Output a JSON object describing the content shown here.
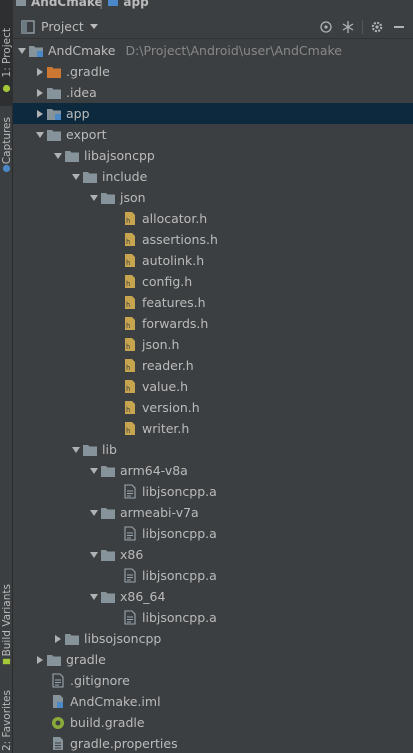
{
  "breadcrumb": {
    "project": "AndCmake",
    "module": "app"
  },
  "left_strip": {
    "tabs": [
      {
        "label": "1: Project"
      },
      {
        "label": "Captures"
      },
      {
        "label": "Build Variants"
      },
      {
        "label": "2: Favorites"
      }
    ]
  },
  "panel": {
    "view_label": "Project"
  },
  "tree": {
    "root": {
      "label": "AndCmake",
      "path": "D:\\Project\\Android\\user\\AndCmake"
    },
    "nodes": [
      {
        "label": ".gradle"
      },
      {
        "label": ".idea"
      },
      {
        "label": "app"
      },
      {
        "label": "export"
      },
      {
        "label": "libajsoncpp"
      },
      {
        "label": "include"
      },
      {
        "label": "json"
      },
      {
        "label": "allocator.h"
      },
      {
        "label": "assertions.h"
      },
      {
        "label": "autolink.h"
      },
      {
        "label": "config.h"
      },
      {
        "label": "features.h"
      },
      {
        "label": "forwards.h"
      },
      {
        "label": "json.h"
      },
      {
        "label": "reader.h"
      },
      {
        "label": "value.h"
      },
      {
        "label": "version.h"
      },
      {
        "label": "writer.h"
      },
      {
        "label": "lib"
      },
      {
        "label": "arm64-v8a"
      },
      {
        "label": "libjsoncpp.a"
      },
      {
        "label": "armeabi-v7a"
      },
      {
        "label": "libjsoncpp.a"
      },
      {
        "label": "x86"
      },
      {
        "label": "libjsoncpp.a"
      },
      {
        "label": "x86_64"
      },
      {
        "label": "libjsoncpp.a"
      },
      {
        "label": "libsojsoncpp"
      },
      {
        "label": "gradle"
      },
      {
        "label": ".gitignore"
      },
      {
        "label": "AndCmake.iml"
      },
      {
        "label": "build.gradle"
      },
      {
        "label": "gradle.properties"
      }
    ]
  },
  "colors": {
    "panel_bg": "#3c3f41",
    "text": "#bbbbbb",
    "path_text": "#888888",
    "folder": "#87939a",
    "header_file": "#c7a54e",
    "module_folder": "#4a88c7",
    "gradle_folder": "#cc7832",
    "selection": "#0d293e"
  }
}
